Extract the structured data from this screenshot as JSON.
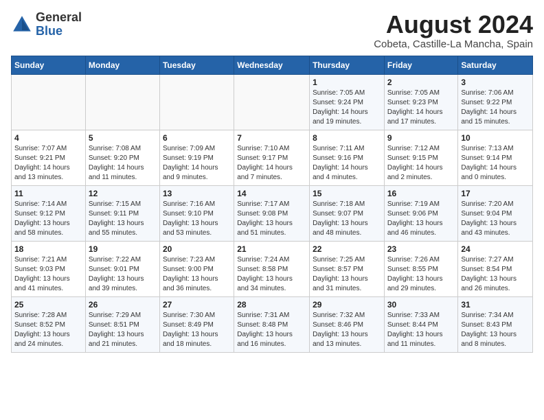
{
  "header": {
    "logo_line1": "General",
    "logo_line2": "Blue",
    "month_year": "August 2024",
    "location": "Cobeta, Castille-La Mancha, Spain"
  },
  "weekdays": [
    "Sunday",
    "Monday",
    "Tuesday",
    "Wednesday",
    "Thursday",
    "Friday",
    "Saturday"
  ],
  "weeks": [
    [
      {
        "day": "",
        "info": ""
      },
      {
        "day": "",
        "info": ""
      },
      {
        "day": "",
        "info": ""
      },
      {
        "day": "",
        "info": ""
      },
      {
        "day": "1",
        "info": "Sunrise: 7:05 AM\nSunset: 9:24 PM\nDaylight: 14 hours\nand 19 minutes."
      },
      {
        "day": "2",
        "info": "Sunrise: 7:05 AM\nSunset: 9:23 PM\nDaylight: 14 hours\nand 17 minutes."
      },
      {
        "day": "3",
        "info": "Sunrise: 7:06 AM\nSunset: 9:22 PM\nDaylight: 14 hours\nand 15 minutes."
      }
    ],
    [
      {
        "day": "4",
        "info": "Sunrise: 7:07 AM\nSunset: 9:21 PM\nDaylight: 14 hours\nand 13 minutes."
      },
      {
        "day": "5",
        "info": "Sunrise: 7:08 AM\nSunset: 9:20 PM\nDaylight: 14 hours\nand 11 minutes."
      },
      {
        "day": "6",
        "info": "Sunrise: 7:09 AM\nSunset: 9:19 PM\nDaylight: 14 hours\nand 9 minutes."
      },
      {
        "day": "7",
        "info": "Sunrise: 7:10 AM\nSunset: 9:17 PM\nDaylight: 14 hours\nand 7 minutes."
      },
      {
        "day": "8",
        "info": "Sunrise: 7:11 AM\nSunset: 9:16 PM\nDaylight: 14 hours\nand 4 minutes."
      },
      {
        "day": "9",
        "info": "Sunrise: 7:12 AM\nSunset: 9:15 PM\nDaylight: 14 hours\nand 2 minutes."
      },
      {
        "day": "10",
        "info": "Sunrise: 7:13 AM\nSunset: 9:14 PM\nDaylight: 14 hours\nand 0 minutes."
      }
    ],
    [
      {
        "day": "11",
        "info": "Sunrise: 7:14 AM\nSunset: 9:12 PM\nDaylight: 13 hours\nand 58 minutes."
      },
      {
        "day": "12",
        "info": "Sunrise: 7:15 AM\nSunset: 9:11 PM\nDaylight: 13 hours\nand 55 minutes."
      },
      {
        "day": "13",
        "info": "Sunrise: 7:16 AM\nSunset: 9:10 PM\nDaylight: 13 hours\nand 53 minutes."
      },
      {
        "day": "14",
        "info": "Sunrise: 7:17 AM\nSunset: 9:08 PM\nDaylight: 13 hours\nand 51 minutes."
      },
      {
        "day": "15",
        "info": "Sunrise: 7:18 AM\nSunset: 9:07 PM\nDaylight: 13 hours\nand 48 minutes."
      },
      {
        "day": "16",
        "info": "Sunrise: 7:19 AM\nSunset: 9:06 PM\nDaylight: 13 hours\nand 46 minutes."
      },
      {
        "day": "17",
        "info": "Sunrise: 7:20 AM\nSunset: 9:04 PM\nDaylight: 13 hours\nand 43 minutes."
      }
    ],
    [
      {
        "day": "18",
        "info": "Sunrise: 7:21 AM\nSunset: 9:03 PM\nDaylight: 13 hours\nand 41 minutes."
      },
      {
        "day": "19",
        "info": "Sunrise: 7:22 AM\nSunset: 9:01 PM\nDaylight: 13 hours\nand 39 minutes."
      },
      {
        "day": "20",
        "info": "Sunrise: 7:23 AM\nSunset: 9:00 PM\nDaylight: 13 hours\nand 36 minutes."
      },
      {
        "day": "21",
        "info": "Sunrise: 7:24 AM\nSunset: 8:58 PM\nDaylight: 13 hours\nand 34 minutes."
      },
      {
        "day": "22",
        "info": "Sunrise: 7:25 AM\nSunset: 8:57 PM\nDaylight: 13 hours\nand 31 minutes."
      },
      {
        "day": "23",
        "info": "Sunrise: 7:26 AM\nSunset: 8:55 PM\nDaylight: 13 hours\nand 29 minutes."
      },
      {
        "day": "24",
        "info": "Sunrise: 7:27 AM\nSunset: 8:54 PM\nDaylight: 13 hours\nand 26 minutes."
      }
    ],
    [
      {
        "day": "25",
        "info": "Sunrise: 7:28 AM\nSunset: 8:52 PM\nDaylight: 13 hours\nand 24 minutes."
      },
      {
        "day": "26",
        "info": "Sunrise: 7:29 AM\nSunset: 8:51 PM\nDaylight: 13 hours\nand 21 minutes."
      },
      {
        "day": "27",
        "info": "Sunrise: 7:30 AM\nSunset: 8:49 PM\nDaylight: 13 hours\nand 18 minutes."
      },
      {
        "day": "28",
        "info": "Sunrise: 7:31 AM\nSunset: 8:48 PM\nDaylight: 13 hours\nand 16 minutes."
      },
      {
        "day": "29",
        "info": "Sunrise: 7:32 AM\nSunset: 8:46 PM\nDaylight: 13 hours\nand 13 minutes."
      },
      {
        "day": "30",
        "info": "Sunrise: 7:33 AM\nSunset: 8:44 PM\nDaylight: 13 hours\nand 11 minutes."
      },
      {
        "day": "31",
        "info": "Sunrise: 7:34 AM\nSunset: 8:43 PM\nDaylight: 13 hours\nand 8 minutes."
      }
    ]
  ]
}
